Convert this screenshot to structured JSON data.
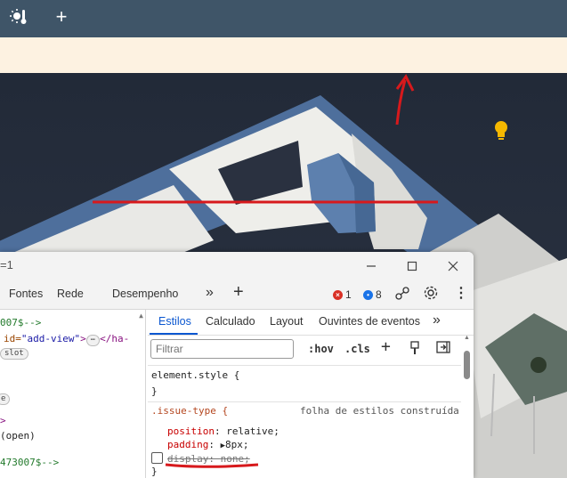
{
  "app": {
    "toolbar_icons": [
      "thermometer-sun-icon",
      "plus-icon"
    ]
  },
  "devtools": {
    "title": "=1",
    "window_controls": [
      "minimize-icon",
      "maximize-icon",
      "close-icon"
    ],
    "tabs": [
      "Fontes",
      "Rede",
      "Desempenho"
    ],
    "errors_count": "1",
    "messages_count": "8",
    "elements": {
      "lines": [
        {
          "text": "007$-->",
          "kind": "comment"
        },
        {
          "attr": "id=",
          "value": "\"add-view\"",
          "tag": "</ha-"
        },
        {
          "chip": "slot"
        },
        {
          "chip": "e"
        },
        {
          "text": ">",
          "kind": "tag"
        },
        {
          "text": "(open)",
          "kind": "plain"
        },
        {
          "text": "473007$-->",
          "kind": "comment"
        }
      ]
    },
    "styles": {
      "tabs": [
        "Estilos",
        "Calculado",
        "Layout",
        "Ouvintes de eventos"
      ],
      "active_tab": "Estilos",
      "filter_placeholder": "Filtrar",
      "hov": ":hov",
      "cls": ".cls",
      "element_style": "element.style {",
      "close_brace": "}",
      "rule_selector": ".issue-type {",
      "rule_source": "folha de estilos construída",
      "declarations": [
        {
          "prop": "position",
          "value": "relative;"
        },
        {
          "prop": "padding",
          "value": "8px;"
        },
        {
          "prop": "display",
          "value": "none;"
        }
      ]
    }
  },
  "colors": {
    "topbar": "#3f5568",
    "banner": "#fdf2e1",
    "annotation": "#d7191c",
    "accent": "#0b57d0",
    "bulb": "#f5b800"
  }
}
